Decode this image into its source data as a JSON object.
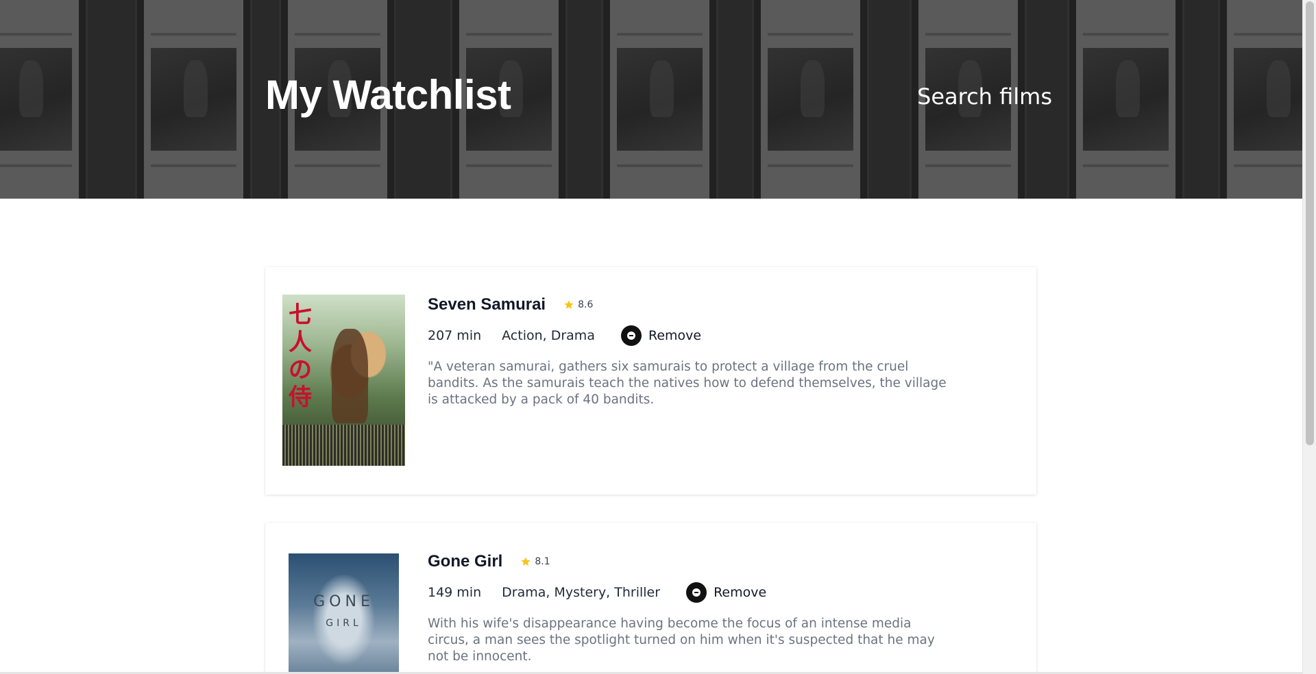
{
  "header": {
    "title": "My Watchlist",
    "search_link": "Search films"
  },
  "films": [
    {
      "title": "Seven Samurai",
      "rating": "8.6",
      "runtime": "207 min",
      "genres": "Action, Drama",
      "remove_label": "Remove",
      "description": "\"A veteran samurai, gathers six samurais to protect a village from the cruel bandits. As the samurais teach the natives how to defend themselves, the village is attacked by a pack of 40 bandits.",
      "poster_text": "七人の侍"
    },
    {
      "title": "Gone Girl",
      "rating": "8.1",
      "runtime": "149 min",
      "genres": "Drama, Mystery, Thriller",
      "remove_label": "Remove",
      "description": "With his wife's disappearance having become the focus of an intense media circus, a man sees the spotlight turned on him when it's suspected that he may not be innocent.",
      "poster_text": "GONE",
      "poster_subtext": "GIRL"
    }
  ],
  "colors": {
    "star": "#f5c518",
    "header_overlay": "#282828",
    "description_text": "#6b7280",
    "remove_icon_bg": "#111111"
  },
  "icons": {
    "rating": "star-icon",
    "remove": "minus-circle-icon"
  }
}
